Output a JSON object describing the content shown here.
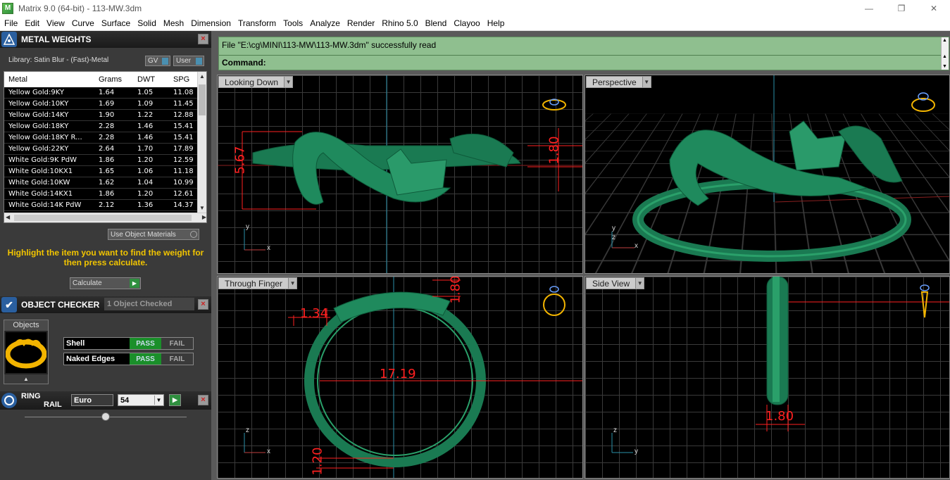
{
  "window": {
    "title": "Matrix 9.0 (64-bit) - 113-MW.3dm",
    "minimize": "—",
    "maximize": "❐",
    "close": "✕"
  },
  "menu": [
    "File",
    "Edit",
    "View",
    "Curve",
    "Surface",
    "Solid",
    "Mesh",
    "Dimension",
    "Transform",
    "Tools",
    "Analyze",
    "Render",
    "Rhino 5.0",
    "Blend",
    "Clayoo",
    "Help"
  ],
  "metal_weights": {
    "title": "METAL WEIGHTS",
    "library": "Library: Satin Blur - (Fast)-Metal",
    "gv_label": "GV",
    "user_label": "User",
    "columns": [
      "Metal",
      "Grams",
      "DWT",
      "SPG"
    ],
    "rows": [
      [
        "Yellow Gold:9KY",
        "1.64",
        "1.05",
        "11.08"
      ],
      [
        "Yellow Gold:10KY",
        "1.69",
        "1.09",
        "11.45"
      ],
      [
        "Yellow Gold:14KY",
        "1.90",
        "1.22",
        "12.88"
      ],
      [
        "Yellow Gold:18KY",
        "2.28",
        "1.46",
        "15.41"
      ],
      [
        "Yellow Gold:18KY R...",
        "2.28",
        "1.46",
        "15.41"
      ],
      [
        "Yellow Gold:22KY",
        "2.64",
        "1.70",
        "17.89"
      ],
      [
        "White Gold:9K PdW",
        "1.86",
        "1.20",
        "12.59"
      ],
      [
        "White Gold:10KX1",
        "1.65",
        "1.06",
        "11.18"
      ],
      [
        "White Gold:10KW",
        "1.62",
        "1.04",
        "10.99"
      ],
      [
        "White Gold:14KX1",
        "1.86",
        "1.20",
        "12.61"
      ],
      [
        "White Gold:14K PdW",
        "2.12",
        "1.36",
        "14.37"
      ]
    ],
    "use_object_materials": "Use Object Materials",
    "hint": "Highlight the item you want to find the weight for then press calculate.",
    "calculate": "Calculate"
  },
  "object_checker": {
    "title": "OBJECT CHECKER",
    "status": "1  Object Checked",
    "objects_label": "Objects",
    "checks": [
      {
        "label": "Shell",
        "pass": "PASS",
        "fail": "FAIL"
      },
      {
        "label": "Naked Edges",
        "pass": "PASS",
        "fail": "FAIL"
      }
    ]
  },
  "ring_rail": {
    "title_line1": "RING",
    "title_line2": "RAIL",
    "standard": "Euro",
    "size": "54"
  },
  "command": {
    "message": "File \"E:\\cg\\MINI\\113-MW\\113-MW.3dm\" successfully read",
    "prompt": "Command:"
  },
  "viewports": [
    {
      "name": "Looking Down",
      "dims": [
        "5.67",
        "1.80"
      ],
      "axes": [
        "y",
        "x"
      ]
    },
    {
      "name": "Perspective",
      "dims": [],
      "axes": [
        "y",
        "z",
        "x"
      ]
    },
    {
      "name": "Through Finger",
      "dims": [
        "1.34",
        "1.80",
        "17.19",
        "1.20"
      ],
      "axes": [
        "z",
        "x"
      ]
    },
    {
      "name": "Side View",
      "dims": [
        "1.80"
      ],
      "axes": [
        "z",
        "y"
      ]
    }
  ],
  "colors": {
    "ring_green": "#1a7a52",
    "dimension_red": "#ff2020",
    "command_bg": "#8fbf8f",
    "hint_yellow": "#f2c500"
  }
}
